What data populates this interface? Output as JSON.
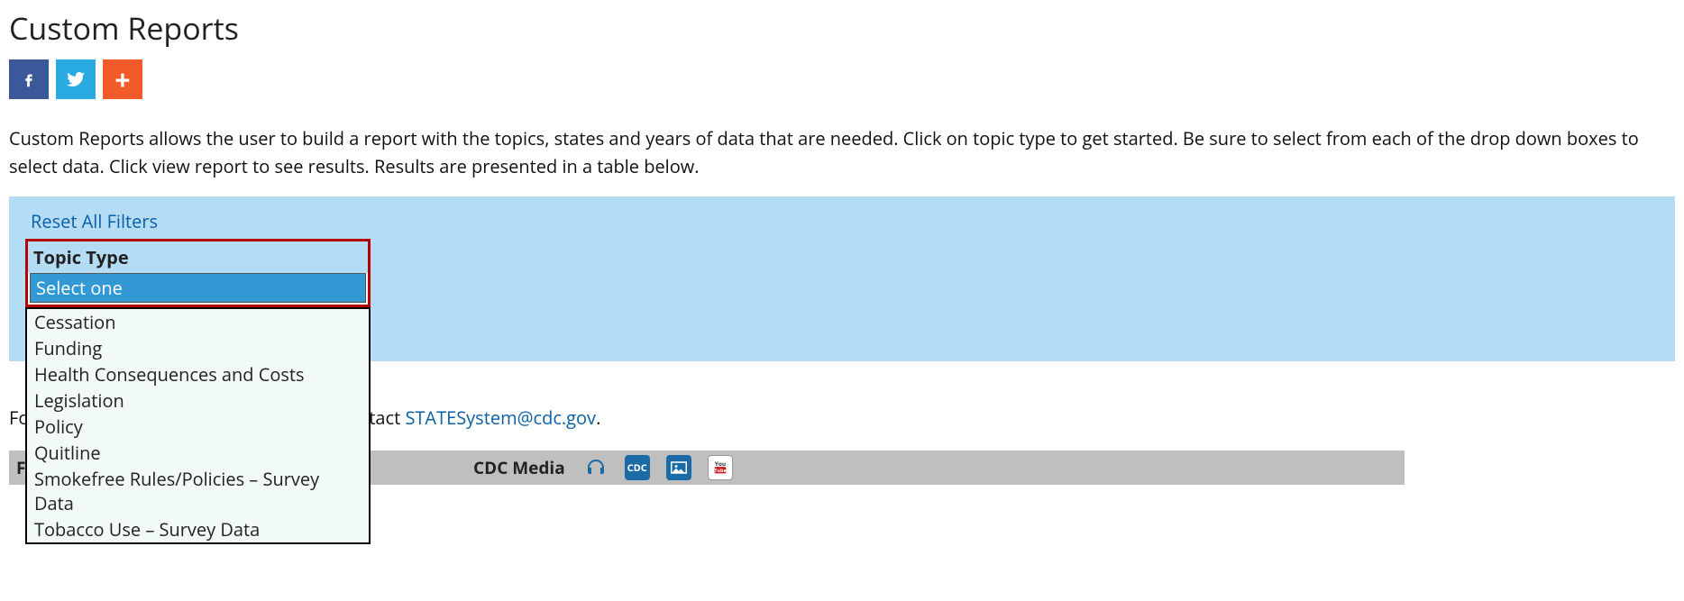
{
  "page_title": "Custom Reports",
  "intro_text": "Custom Reports allows the user to build a report with the topics, states and years of data that are needed. Click on topic type to get started. Be sure to select from each of the drop down boxes to select data. Click view report to see results. Results are presented in a table below.",
  "filters": {
    "reset_label": "Reset All Filters",
    "topic_type_label": "Topic Type",
    "selected_option": "Select one",
    "options": [
      "Cessation",
      "Funding",
      "Health Consequences and Costs",
      "Legislation",
      "Policy",
      "Quitline",
      "Smokefree Rules/Policies – Survey Data",
      "Tobacco Use – Survey Data"
    ]
  },
  "contact": {
    "prefix_visible": "Fo",
    "suffix_visible": "ta, contact ",
    "email": "STATESystem@cdc.gov",
    "period": "."
  },
  "footer": {
    "follow_label": "Follow CDC",
    "media_label": "CDC Media"
  }
}
